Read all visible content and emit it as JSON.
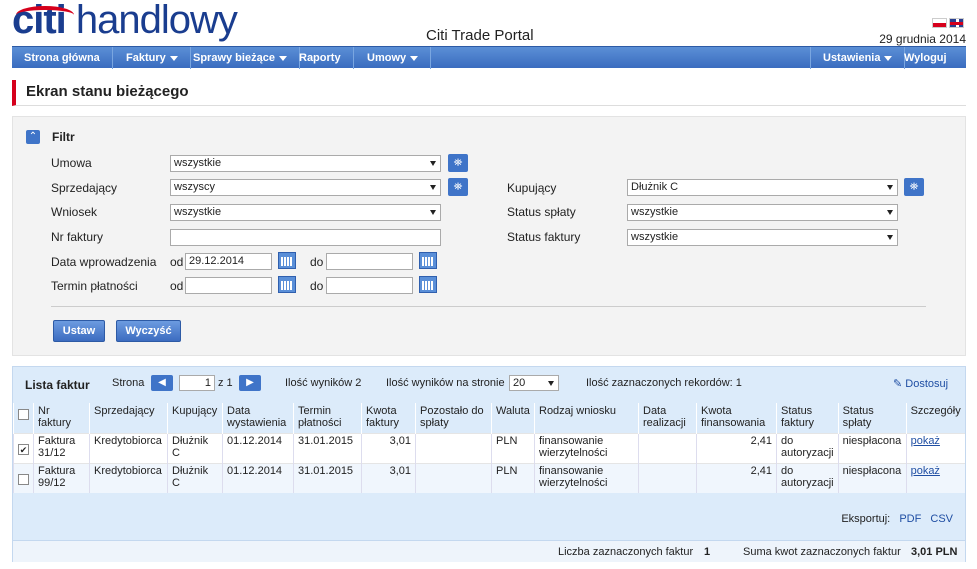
{
  "header": {
    "brand": "citi",
    "brand_suffix": "handlowy",
    "portal_title": "Citi Trade Portal",
    "date": "29 grudnia 2014"
  },
  "nav": {
    "items": [
      {
        "label": "Strona główna",
        "dropdown": false
      },
      {
        "label": "Faktury",
        "dropdown": true
      },
      {
        "label": "Sprawy bieżące",
        "dropdown": true
      },
      {
        "label": "Raporty",
        "dropdown": false
      },
      {
        "label": "Umowy",
        "dropdown": true
      }
    ],
    "right_items": [
      {
        "label": "Ustawienia",
        "dropdown": true
      },
      {
        "label": "Wyloguj",
        "dropdown": false
      }
    ]
  },
  "page_title": "Ekran stanu bieżącego",
  "filter": {
    "title": "Filtr",
    "umowa_label": "Umowa",
    "umowa_value": "wszystkie",
    "sprzedajacy_label": "Sprzedający",
    "sprzedajacy_value": "wszyscy",
    "wniosek_label": "Wniosek",
    "wniosek_value": "wszystkie",
    "nr_faktury_label": "Nr faktury",
    "nr_faktury_value": "",
    "data_wprowadzenia_label": "Data wprowadzenia",
    "termin_platnosci_label": "Termin płatności",
    "od_label": "od",
    "do_label": "do",
    "data_od_value": "29.12.2014",
    "data_do_value": "",
    "termin_od_value": "",
    "termin_do_value": "",
    "kupujacy_label": "Kupujący",
    "kupujacy_value": "Dłużnik C",
    "status_splaty_label": "Status spłaty",
    "status_splaty_value": "wszystkie",
    "status_faktury_label": "Status faktury",
    "status_faktury_value": "wszystkie",
    "ustaw_button": "Ustaw",
    "wyczysc_button": "Wyczyść"
  },
  "list": {
    "title": "Lista faktur",
    "strona_label": "Strona",
    "page_current": "1",
    "page_total_label": "z 1",
    "results_label": "Ilość wyników 2",
    "per_page_label": "Ilość wyników na stronie",
    "per_page_value": "20",
    "selected_label": "Ilość zaznaczonych rekordów: 1",
    "customize_label": "Dostosuj",
    "columns": [
      "Nr faktury",
      "Sprzedający",
      "Kupujący",
      "Data wystawienia",
      "Termin płatności",
      "Kwota faktury",
      "Pozostało do spłaty",
      "Waluta",
      "Rodzaj wniosku",
      "Data realizacji",
      "Kwota finansowania",
      "Status faktury",
      "Status spłaty",
      "Szczegóły"
    ],
    "rows": [
      {
        "checked": true,
        "nr": "Faktura 31/12",
        "sprzedajacy": "Kredytobiorca",
        "kupujacy": "Dłużnik C",
        "data_wyst": "01.12.2014",
        "termin": "31.01.2015",
        "kwota": "3,01",
        "pozostalo": "",
        "waluta": "PLN",
        "rodzaj": "finansowanie wierzytelności",
        "data_real": "",
        "kwota_fin": "2,41",
        "status_fakt": "do autoryzacji",
        "status_spl": "niespłacona",
        "szczegoly": "pokaż"
      },
      {
        "checked": false,
        "nr": "Faktura 99/12",
        "sprzedajacy": "Kredytobiorca",
        "kupujacy": "Dłużnik C",
        "data_wyst": "01.12.2014",
        "termin": "31.01.2015",
        "kwota": "3,01",
        "pozostalo": "",
        "waluta": "PLN",
        "rodzaj": "finansowanie wierzytelności",
        "data_real": "",
        "kwota_fin": "2,41",
        "status_fakt": "do autoryzacji",
        "status_spl": "niespłacona",
        "szczegoly": "pokaż"
      }
    ],
    "export_label": "Eksportuj:",
    "export_pdf": "PDF",
    "export_csv": "CSV",
    "footer_count_label": "Liczba zaznaczonych faktur",
    "footer_count_value": "1",
    "footer_sum_label": "Suma kwot zaznaczonych faktur",
    "footer_sum_value": "3,01 PLN"
  }
}
